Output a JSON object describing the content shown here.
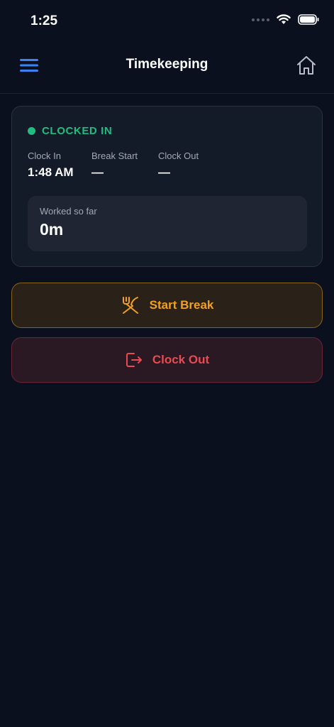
{
  "status_bar": {
    "time": "1:25"
  },
  "nav": {
    "title": "Timekeeping",
    "menu_icon": "hamburger-icon",
    "home_icon": "home-icon"
  },
  "status_card": {
    "status_label": "CLOCKED IN",
    "status_color": "#1fbd7f",
    "clock_in": {
      "label": "Clock In",
      "value": "1:48 AM"
    },
    "break_start": {
      "label": "Break Start",
      "value": "—"
    },
    "clock_out": {
      "label": "Clock Out",
      "value": "—"
    },
    "worked": {
      "label": "Worked so far",
      "value": "0m"
    }
  },
  "actions": {
    "start_break": {
      "label": "Start Break",
      "icon": "fork-knife-icon",
      "color": "#f2a11f"
    },
    "clock_out": {
      "label": "Clock Out",
      "icon": "logout-icon",
      "color": "#ea4a53"
    }
  }
}
